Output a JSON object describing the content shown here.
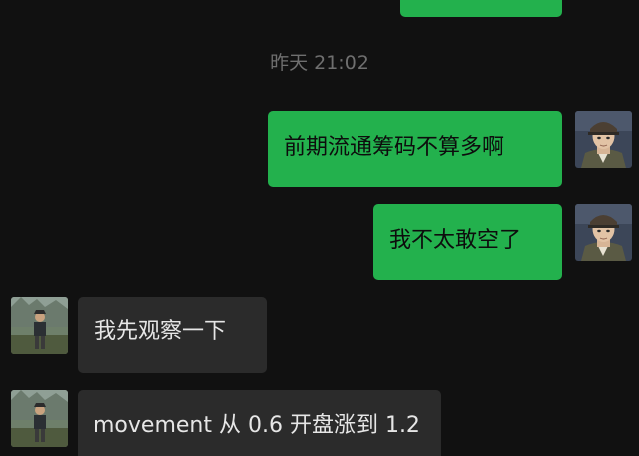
{
  "timestamp": "昨天 21:02",
  "messages": {
    "m1": {
      "text": "前期流通筹码不算多啊",
      "sender": "me"
    },
    "m2": {
      "text": "我不太敢空了",
      "sender": "me"
    },
    "m3": {
      "text": "我先观察一下",
      "sender": "other"
    },
    "m4": {
      "text": "movement 从 0.6 开盘涨到 1.2",
      "sender": "other"
    }
  },
  "colors": {
    "background": "#111111",
    "outgoing_bubble": "#23b14d",
    "incoming_bubble": "#2b2b2b",
    "timestamp_text": "#6f6f6f"
  },
  "icons": {
    "self_avatar": "anime-soldier-avatar",
    "other_avatar": "hiker-photo-avatar"
  }
}
